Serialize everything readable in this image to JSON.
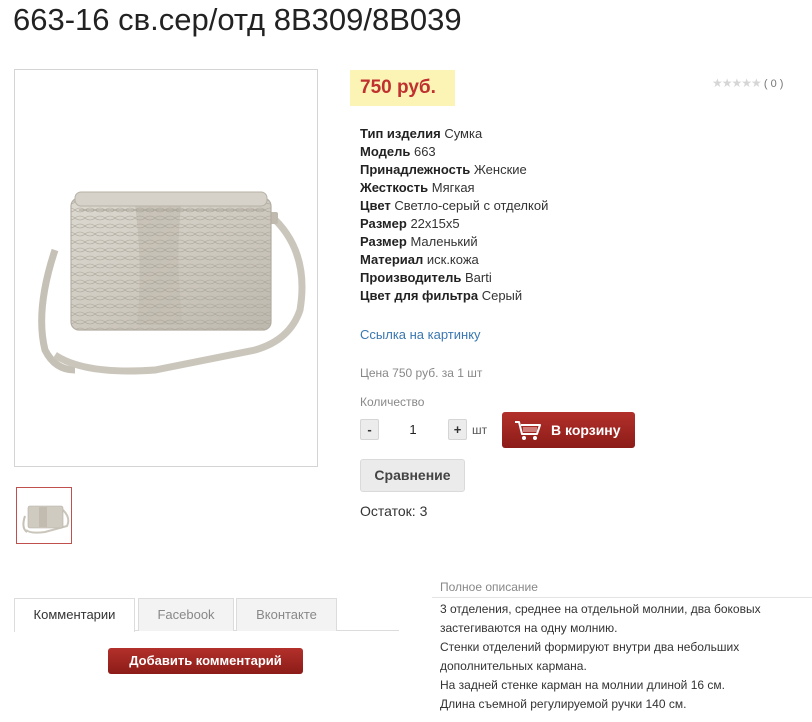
{
  "product": {
    "title": "663-16 св.сер/отд 8B309/8B039",
    "price": "750 руб.",
    "rating_count": "( 0 )",
    "stars": "★★★★★"
  },
  "specs": [
    {
      "key": "Тип изделия",
      "value": "Сумка"
    },
    {
      "key": "Модель",
      "value": "663"
    },
    {
      "key": "Принадлежность",
      "value": "Женские"
    },
    {
      "key": "Жесткость",
      "value": "Мягкая"
    },
    {
      "key": "Цвет",
      "value": "Светло-серый с отделкой"
    },
    {
      "key": "Размер",
      "value": "22x15x5"
    },
    {
      "key": "Размер",
      "value": "Маленький"
    },
    {
      "key": "Материал",
      "value": "иск.кожа"
    },
    {
      "key": "Производитель",
      "value": "Barti"
    },
    {
      "key": "Цвет для фильтра",
      "value": "Серый"
    }
  ],
  "image_link": "Ссылка на картинку",
  "price_per_unit": "Цена 750 руб. за 1 шт",
  "quantity": {
    "label": "Количество",
    "minus": "-",
    "value": "1",
    "plus": "+",
    "unit": "шт"
  },
  "cart_button": "В корзину",
  "compare_button": "Сравнение",
  "stock": "Остаток: 3",
  "tabs": [
    {
      "label": "Комментарии",
      "active": true
    },
    {
      "label": "Facebook",
      "active": false
    },
    {
      "label": "Вконтакте",
      "active": false
    }
  ],
  "add_comment_button": "Добавить комментарий",
  "description": {
    "title": "Полное описание",
    "lines": [
      "3 отделения, среднее на отдельной молнии, два боковых",
      "застегиваются на одну молнию.",
      "Стенки отделений формируют внутри два небольших",
      "дополнительных кармана.",
      "На задней стенке карман на молнии длиной 16 см.",
      "Длина съемной регулируемой ручки 140 см."
    ]
  },
  "colors": {
    "price_highlight": "#fbf4b4",
    "price_text": "#c0302f",
    "primary_button": "#a3271f",
    "link": "#3a77b0"
  },
  "icons": [
    "cart-icon",
    "star-icon"
  ]
}
